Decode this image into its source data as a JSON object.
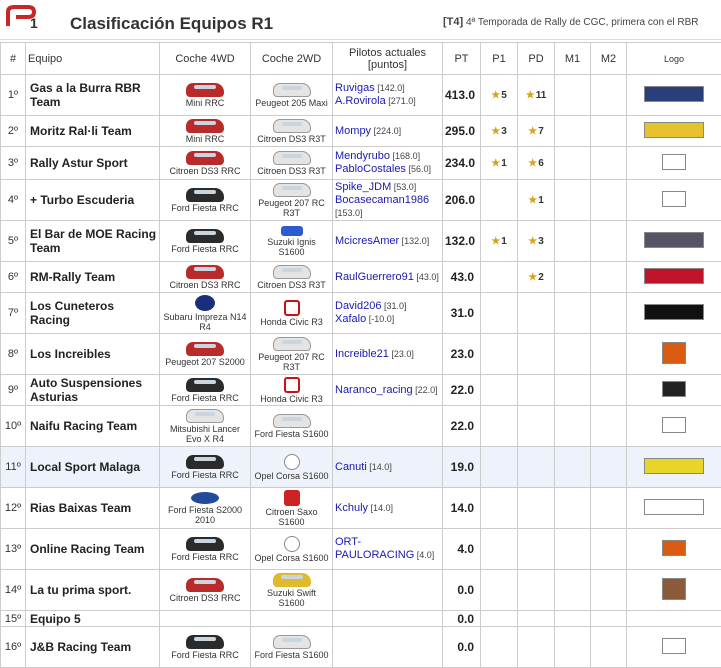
{
  "header": {
    "title": "Clasificación Equipos R1",
    "season_tag": "[T4]",
    "season_text": "4ª Temporada de Rally de CGC, primera con el RBR"
  },
  "columns": [
    "#",
    "Equipo",
    "Coche 4WD",
    "Coche 2WD",
    "Pilotos actuales [puntos]",
    "PT",
    "P1",
    "PD",
    "M1",
    "M2",
    "Logo"
  ],
  "rows": [
    {
      "pos": "1º",
      "team": "Gas a la Burra RBR Team",
      "car4": "Mini RRC",
      "car2": "Peugeot 205 Maxi",
      "c4": "red",
      "c2": "white",
      "pilots": [
        {
          "n": "Ruvigas",
          "p": "[142.0]"
        },
        {
          "n": "A.Rovirola",
          "p": "[271.0]"
        }
      ],
      "pt": "413.0",
      "p1": "5",
      "pd": "11"
    },
    {
      "pos": "2º",
      "team": "Moritz Ral·li Team",
      "car4": "Mini RRC",
      "car2": "Citroen DS3 R3T",
      "c4": "red",
      "c2": "white",
      "pilots": [
        {
          "n": "Mompy",
          "p": "[224.0]"
        }
      ],
      "pt": "295.0",
      "p1": "3",
      "pd": "7"
    },
    {
      "pos": "3º",
      "team": "Rally Astur Sport",
      "car4": "Citroen DS3 RRC",
      "car2": "Citroen DS3 R3T",
      "c4": "red",
      "c2": "white",
      "pilots": [
        {
          "n": "Mendyrubo",
          "p": "[168.0]"
        },
        {
          "n": "PabloCostales",
          "p": "[56.0]"
        }
      ],
      "pt": "234.0",
      "p1": "1",
      "pd": "6"
    },
    {
      "pos": "4º",
      "team": "+ Turbo Escuderia",
      "car4": "Ford Fiesta RRC",
      "car2": "Peugeot 207 RC R3T",
      "c4": "",
      "c2": "white",
      "pilots": [
        {
          "n": "Spike_JDM",
          "p": "[53.0]"
        },
        {
          "n": "Bocasecaman1986",
          "p": "[153.0]"
        }
      ],
      "pt": "206.0",
      "p1": "",
      "pd": "1"
    },
    {
      "pos": "5º",
      "team": "El Bar de MOE Racing Team",
      "car4": "Ford Fiesta RRC",
      "car2": "Suzuki Ignis S1600",
      "c4": "",
      "c2": "suzuki",
      "pilots": [
        {
          "n": "McicresAmer",
          "p": "[132.0]"
        }
      ],
      "pt": "132.0",
      "p1": "1",
      "pd": "3"
    },
    {
      "pos": "6º",
      "team": "RM-Rally Team",
      "car4": "Citroen DS3 RRC",
      "car2": "Citroen DS3 R3T",
      "c4": "red",
      "c2": "white",
      "pilots": [
        {
          "n": "RaulGuerrero91",
          "p": "[43.0]"
        }
      ],
      "pt": "43.0",
      "p1": "",
      "pd": "2"
    },
    {
      "pos": "7º",
      "team": "Los Cuneteros Racing",
      "car4": "Subaru Impreza N14 R4",
      "car2": "Honda Civic R3",
      "c4": "subaru",
      "c2": "honda",
      "pilots": [
        {
          "n": "David206",
          "p": "[31.0]"
        },
        {
          "n": "Xafalo",
          "p": "[-10.0]"
        }
      ],
      "pt": "31.0",
      "p1": "",
      "pd": ""
    },
    {
      "pos": "8º",
      "team": "Los Increibles",
      "car4": "Peugeot 207 S2000",
      "car2": "Peugeot 207 RC R3T",
      "c4": "red",
      "c2": "white",
      "pilots": [
        {
          "n": "Increible21",
          "p": "[23.0]"
        }
      ],
      "pt": "23.0",
      "p1": "",
      "pd": ""
    },
    {
      "pos": "9º",
      "team": "Auto Suspensiones Asturias",
      "car4": "Ford Fiesta RRC",
      "car2": "Honda Civic R3",
      "c4": "",
      "c2": "honda",
      "pilots": [
        {
          "n": "Naranco_racing",
          "p": "[22.0]"
        }
      ],
      "pt": "22.0",
      "p1": "",
      "pd": ""
    },
    {
      "pos": "10º",
      "team": "Naifu Racing Team",
      "car4": "Mitsubishi Lancer Evo X R4",
      "car2": "Ford Fiesta S1600",
      "c4": "white",
      "c2": "white",
      "pilots": [],
      "pt": "22.0",
      "p1": "",
      "pd": ""
    },
    {
      "pos": "11º",
      "team": "Local Sport Malaga",
      "car4": "Ford Fiesta RRC",
      "car2": "Opel Corsa S1600",
      "c4": "",
      "c2": "opel",
      "pilots": [
        {
          "n": "Canuti",
          "p": "[14.0]"
        }
      ],
      "pt": "19.0",
      "p1": "",
      "pd": ""
    },
    {
      "pos": "12º",
      "team": "Rias Baixas Team",
      "car4": "Ford Fiesta S2000 2010",
      "car2": "Citroen Saxo S1600",
      "c4": "ford",
      "c2": "citroen",
      "pilots": [
        {
          "n": "Kchuly",
          "p": "[14.0]"
        }
      ],
      "pt": "14.0",
      "p1": "",
      "pd": ""
    },
    {
      "pos": "13º",
      "team": "Online Racing Team",
      "car4": "Ford Fiesta RRC",
      "car2": "Opel Corsa S1600",
      "c4": "",
      "c2": "opel",
      "pilots": [
        {
          "n": "ORT-PAULORACING",
          "p": "[4.0]"
        }
      ],
      "pt": "4.0",
      "p1": "",
      "pd": ""
    },
    {
      "pos": "14º",
      "team": "La tu prima sport.",
      "car4": "Citroen DS3 RRC",
      "car2": "Suzuki Swift S1600",
      "c4": "red",
      "c2": "yellow",
      "pilots": [],
      "pt": "0.0",
      "p1": "",
      "pd": ""
    },
    {
      "pos": "15º",
      "team": "Equipo 5",
      "car4": "",
      "car2": "",
      "c4": "none",
      "c2": "none",
      "pilots": [],
      "pt": "0.0",
      "p1": "",
      "pd": ""
    },
    {
      "pos": "16º",
      "team": "J&B Racing Team",
      "car4": "Ford Fiesta RRC",
      "car2": "Ford Fiesta S1600",
      "c4": "",
      "c2": "white",
      "pilots": [],
      "pt": "0.0",
      "p1": "",
      "pd": ""
    }
  ]
}
